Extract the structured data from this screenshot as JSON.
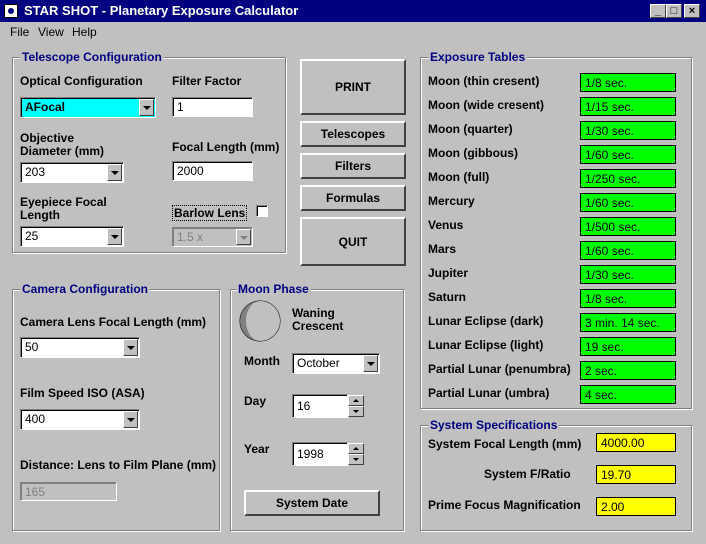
{
  "window": {
    "title": "STAR SHOT - Planetary Exposure Calculator",
    "min": "_",
    "max": "□",
    "close": "×"
  },
  "menu": [
    "File",
    "View",
    "Help"
  ],
  "telescope": {
    "title": "Telescope Configuration",
    "optical_label": "Optical Configuration",
    "optical_value": "AFocal",
    "filter_label": "Filter Factor",
    "filter_value": "1",
    "objective_label_1": "Objective",
    "objective_label_2": "Diameter (mm)",
    "objective_value": "203",
    "focal_label": "Focal Length (mm)",
    "focal_value": "2000",
    "eyepiece_label_1": "Eyepiece Focal",
    "eyepiece_label_2": "Length",
    "eyepiece_value": "25",
    "barlow_label": "Barlow Lens",
    "barlow_value": "1.5 x"
  },
  "buttons": {
    "print": "PRINT",
    "telescopes": "Telescopes",
    "filters": "Filters",
    "formulas": "Formulas",
    "quit": "QUIT",
    "system_date": "System Date"
  },
  "camera": {
    "title": "Camera Configuration",
    "lens_label": "Camera Lens Focal Length (mm)",
    "lens_value": "50",
    "film_label": "Film Speed ISO (ASA)",
    "film_value": "400",
    "distance_label": "Distance: Lens to Film Plane (mm)",
    "distance_value": "165"
  },
  "moon": {
    "title": "Moon Phase",
    "phase_1": "Waning",
    "phase_2": "Crescent",
    "month_label": "Month",
    "month_value": "October",
    "day_label": "Day",
    "day_value": "16",
    "year_label": "Year",
    "year_value": "1998"
  },
  "exposure": {
    "title": "Exposure Tables",
    "rows": [
      {
        "label": "Moon (thin cresent)",
        "value": "1/8 sec."
      },
      {
        "label": "Moon (wide cresent)",
        "value": "1/15 sec."
      },
      {
        "label": "Moon (quarter)",
        "value": "1/30 sec."
      },
      {
        "label": "Moon (gibbous)",
        "value": "1/60 sec."
      },
      {
        "label": "Moon (full)",
        "value": "1/250 sec."
      },
      {
        "label": "Mercury",
        "value": "1/60 sec."
      },
      {
        "label": "Venus",
        "value": "1/500 sec."
      },
      {
        "label": "Mars",
        "value": "1/60 sec."
      },
      {
        "label": "Jupiter",
        "value": "1/30 sec."
      },
      {
        "label": "Saturn",
        "value": "1/8 sec."
      },
      {
        "label": "Lunar Eclipse (dark)",
        "value": "3 min. 14 sec."
      },
      {
        "label": "Lunar Eclipse (light)",
        "value": "19 sec."
      },
      {
        "label": "Partial Lunar (penumbra)",
        "value": "2 sec."
      },
      {
        "label": "Partial Lunar (umbra)",
        "value": "4 sec."
      }
    ]
  },
  "system": {
    "title": "System Specifications",
    "focal_label": "System Focal Length (mm)",
    "focal_value": "4000.00",
    "ratio_label": "System F/Ratio",
    "ratio_value": "19.70",
    "mag_label": "Prime Focus Magnification",
    "mag_value": "2.00"
  },
  "colors": {
    "title_bar": "#000080",
    "group_title": "#000080",
    "exposure_value": "#00ff00",
    "spec_value": "#ffff00",
    "selected_combo": "#00ffff"
  }
}
